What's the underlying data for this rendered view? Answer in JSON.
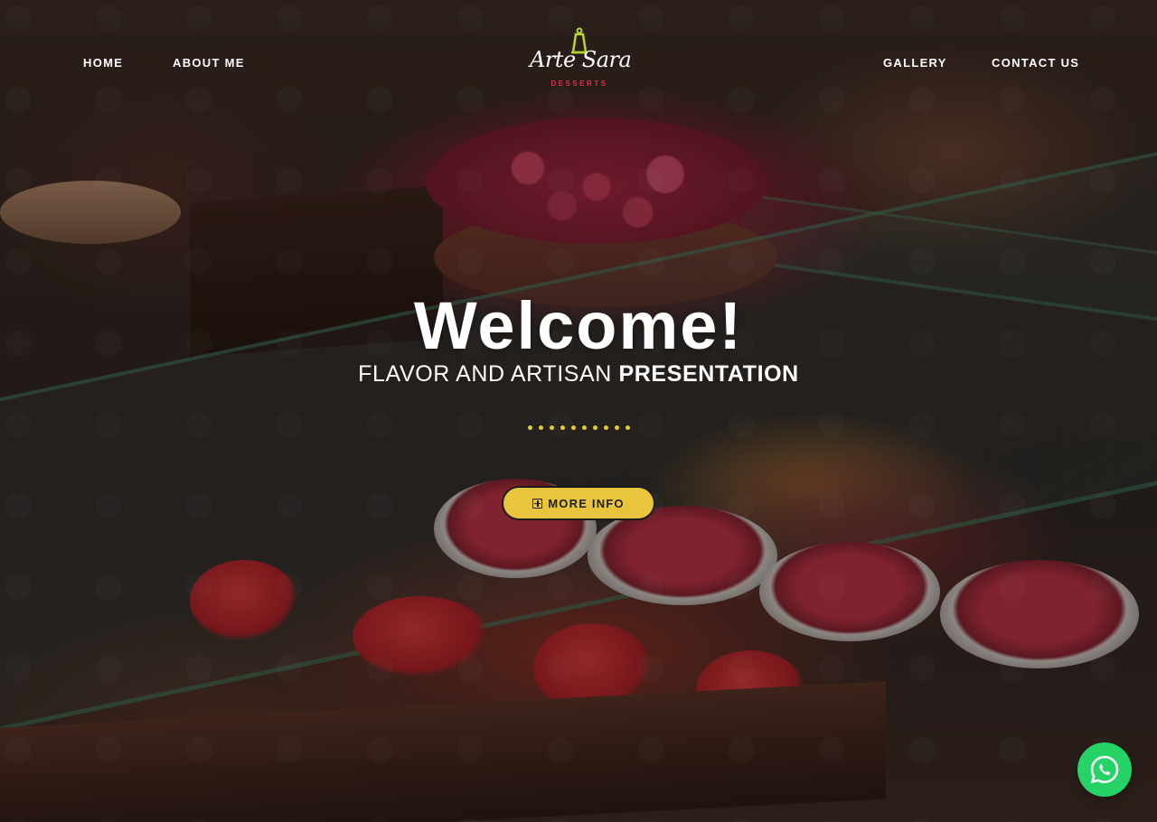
{
  "nav": {
    "left": [
      {
        "label": "HOME"
      },
      {
        "label": "ABOUT ME"
      }
    ],
    "right": [
      {
        "label": "GALLERY"
      },
      {
        "label": "CONTACT US"
      }
    ]
  },
  "logo": {
    "name": "Arte Sara",
    "tagline": "DESSERTS",
    "icon": "cake-icon"
  },
  "hero": {
    "title": "Welcome!",
    "subtitle_light": "FLAVOR AND ARTISAN",
    "subtitle_bold": "PRESENTATION",
    "separator_color": "#e8c93a",
    "cta": {
      "label": "MORE INFO",
      "icon": "plus-square-icon",
      "background": "#e9c53e"
    }
  },
  "floating": {
    "whatsapp": {
      "icon": "whatsapp-icon",
      "color": "#25d366"
    }
  }
}
